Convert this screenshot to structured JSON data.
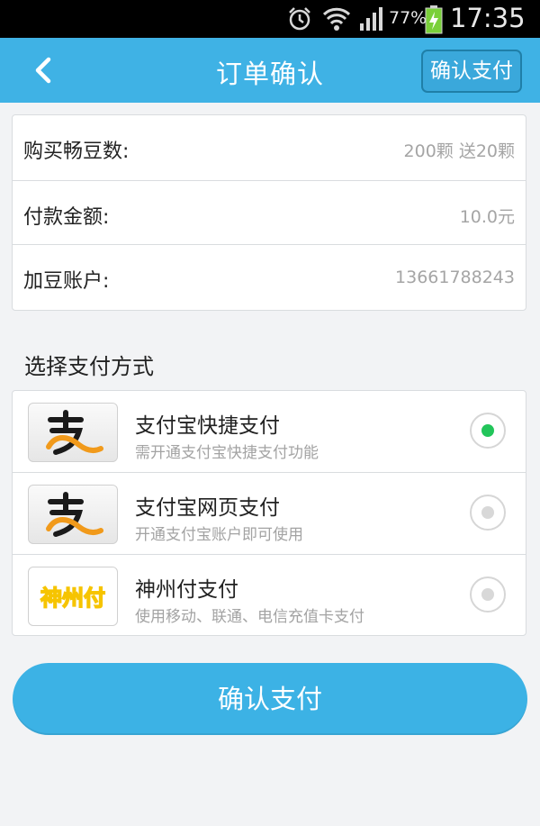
{
  "status_bar": {
    "battery_percent": "77%",
    "time": "17:35",
    "icons": [
      "alarm-icon",
      "wifi-icon",
      "signal-icon",
      "battery-charging-icon"
    ]
  },
  "nav": {
    "title": "订单确认",
    "confirm_label": "确认支付",
    "back_icon": "chevron-left-icon"
  },
  "order_info": [
    {
      "label": "购买畅豆数:",
      "value": "200颗 送20颗"
    },
    {
      "label": "付款金额:",
      "value": "10.0元"
    },
    {
      "label": "加豆账户:",
      "value": "13661788243"
    }
  ],
  "payment_section": {
    "title": "选择支付方式",
    "methods": [
      {
        "name": "支付宝快捷支付",
        "desc": "需开通支付宝快捷支付功能",
        "logo": "alipay-logo",
        "selected": true
      },
      {
        "name": "支付宝网页支付",
        "desc": "开通支付宝账户即可使用",
        "logo": "alipay-logo",
        "selected": false
      },
      {
        "name": "神州付支付",
        "desc": "使用移动、联通、电信充值卡支付",
        "logo": "shenzhoufu-logo",
        "logo_text": "神州付",
        "selected": false
      }
    ]
  },
  "pay_button": {
    "label": "确认支付"
  },
  "colors": {
    "primary": "#3fb2e5",
    "selected_radio": "#22c55a",
    "background": "#f2f3f5"
  }
}
